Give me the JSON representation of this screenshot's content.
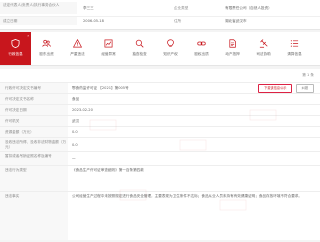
{
  "top_info": {
    "row1": {
      "label_left": "法定代表人/负责人/执行事务合伙人",
      "value_left": "李三三",
      "label_right": "企业类型",
      "value_right": "有限责任公司（自然人投资）"
    },
    "row2": {
      "label_left": "成立日期",
      "value_left": "2006-05-18",
      "label_right": "住所",
      "value_right": "湖北省武汉市"
    }
  },
  "tabs": [
    {
      "label": "行政信息",
      "count": "7",
      "icon": "shield-icon",
      "active": true
    },
    {
      "label": "股东出资",
      "count": "",
      "icon": "people-icon",
      "active": false
    },
    {
      "label": "严重违法",
      "count": "",
      "icon": "warning-icon",
      "active": false
    },
    {
      "label": "经营异常",
      "count": "",
      "icon": "chart-icon",
      "active": false
    },
    {
      "label": "抽查检查",
      "count": "",
      "icon": "search-icon",
      "active": false
    },
    {
      "label": "知识产权",
      "count": "",
      "icon": "bulb-icon",
      "active": false
    },
    {
      "label": "股权出质",
      "count": "",
      "icon": "chain-icon",
      "active": false
    },
    {
      "label": "动产抵押",
      "count": "",
      "icon": "document-icon",
      "active": false
    },
    {
      "label": "司法协助",
      "count": "",
      "icon": "gavel-icon",
      "active": false
    },
    {
      "label": "清算信息",
      "count": "",
      "icon": "list-icon",
      "active": false
    }
  ],
  "pager_text": "第 1 条",
  "detail_rows": [
    {
      "label": "行政许可决定文书编号",
      "value": "鄂食药监许可证 【2021】第005号"
    },
    {
      "label": "许可决定文书名称",
      "value": "食品"
    },
    {
      "label": "许可决定日期",
      "value": "2023-02-20"
    },
    {
      "label": "许可机关",
      "value": "武汉"
    },
    {
      "label": "资源金额（万元）",
      "value": "0.0"
    },
    {
      "label": "没收违法所得、没收非法财物金额（万元）",
      "value": "0.0"
    },
    {
      "label": "暂扣或者吊销证照名称及编号",
      "value": "一"
    },
    {
      "label": "违法行为类型",
      "value": "《食品生产许可证审查细则》第一百条第四款"
    },
    {
      "label": "违法事实",
      "value": "公司经营生产过程中未按照规定进行食品安全管理，主要表现为卫生条件不达标；食品从业人员未持有有效健康证明；食品存放环境不符合要求。"
    }
  ],
  "buttons": {
    "download": "下载该信息公示",
    "report": "纠错"
  },
  "colors": {
    "accent": "#c8161d",
    "label_bg": "#f8f8f8",
    "page_bg": "#f4f4f4"
  }
}
